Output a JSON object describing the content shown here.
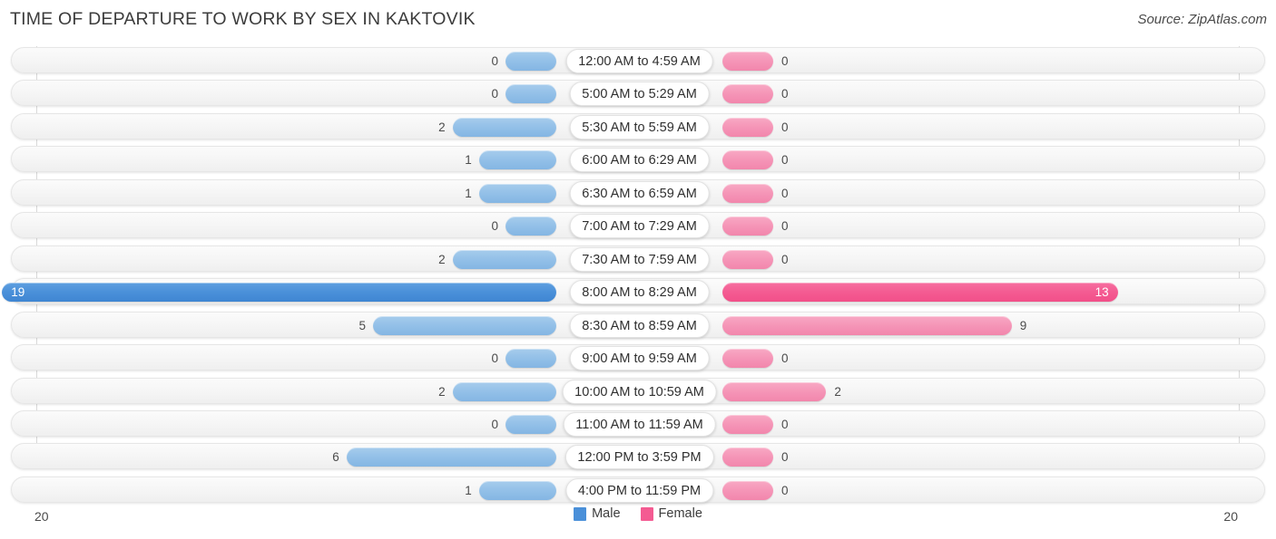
{
  "header": {
    "title": "TIME OF DEPARTURE TO WORK BY SEX IN KAKTOVIK",
    "source": "Source: ZipAtlas.com"
  },
  "axis": {
    "left_max": "20",
    "right_max": "20"
  },
  "legend": {
    "items": [
      {
        "label": "Male",
        "color": "#4a90d9"
      },
      {
        "label": "Female",
        "color": "#f45b92"
      }
    ]
  },
  "colors": {
    "male_light": "#93c0e8",
    "female_light": "#f595b7",
    "male_strong": "#4a90d9",
    "female_strong": "#f45b92",
    "row_background": "#f5f5f5",
    "gridline": "#d9d9d9"
  },
  "chart_data": {
    "type": "bar",
    "title": "TIME OF DEPARTURE TO WORK BY SEX IN KAKTOVIK",
    "subtitle": "Source: ZipAtlas.com",
    "orientation": "horizontal-diverging",
    "xlabel": "",
    "ylabel": "",
    "xlim": [
      20,
      20
    ],
    "axis_tick_labels": [
      "20",
      "20"
    ],
    "grid": true,
    "legend_position": "bottom-center",
    "categories": [
      "12:00 AM to 4:59 AM",
      "5:00 AM to 5:29 AM",
      "5:30 AM to 5:59 AM",
      "6:00 AM to 6:29 AM",
      "6:30 AM to 6:59 AM",
      "7:00 AM to 7:29 AM",
      "7:30 AM to 7:59 AM",
      "8:00 AM to 8:29 AM",
      "8:30 AM to 8:59 AM",
      "9:00 AM to 9:59 AM",
      "10:00 AM to 10:59 AM",
      "11:00 AM to 11:59 AM",
      "12:00 PM to 3:59 PM",
      "4:00 PM to 11:59 PM"
    ],
    "series": [
      {
        "name": "Male",
        "values": [
          0,
          0,
          2,
          1,
          1,
          0,
          2,
          19,
          5,
          0,
          2,
          0,
          6,
          1
        ]
      },
      {
        "name": "Female",
        "values": [
          0,
          0,
          0,
          0,
          0,
          0,
          0,
          13,
          9,
          0,
          2,
          0,
          0,
          0
        ]
      }
    ],
    "highlighted_category": "8:00 AM to 8:29 AM"
  },
  "rows": [
    {
      "label": "12:00 AM to 4:59 AM",
      "male": "0",
      "female": "0",
      "male_value": 0,
      "female_value": 0,
      "highlight": false
    },
    {
      "label": "5:00 AM to 5:29 AM",
      "male": "0",
      "female": "0",
      "male_value": 0,
      "female_value": 0,
      "highlight": false
    },
    {
      "label": "5:30 AM to 5:59 AM",
      "male": "2",
      "female": "0",
      "male_value": 2,
      "female_value": 0,
      "highlight": false
    },
    {
      "label": "6:00 AM to 6:29 AM",
      "male": "1",
      "female": "0",
      "male_value": 1,
      "female_value": 0,
      "highlight": false
    },
    {
      "label": "6:30 AM to 6:59 AM",
      "male": "1",
      "female": "0",
      "male_value": 1,
      "female_value": 0,
      "highlight": false
    },
    {
      "label": "7:00 AM to 7:29 AM",
      "male": "0",
      "female": "0",
      "male_value": 0,
      "female_value": 0,
      "highlight": false
    },
    {
      "label": "7:30 AM to 7:59 AM",
      "male": "2",
      "female": "0",
      "male_value": 2,
      "female_value": 0,
      "highlight": false
    },
    {
      "label": "8:00 AM to 8:29 AM",
      "male": "19",
      "female": "13",
      "male_value": 19,
      "female_value": 13,
      "highlight": true
    },
    {
      "label": "8:30 AM to 8:59 AM",
      "male": "5",
      "female": "9",
      "male_value": 5,
      "female_value": 9,
      "highlight": false
    },
    {
      "label": "9:00 AM to 9:59 AM",
      "male": "0",
      "female": "0",
      "male_value": 0,
      "female_value": 0,
      "highlight": false
    },
    {
      "label": "10:00 AM to 10:59 AM",
      "male": "2",
      "female": "2",
      "male_value": 2,
      "female_value": 2,
      "highlight": false
    },
    {
      "label": "11:00 AM to 11:59 AM",
      "male": "0",
      "female": "0",
      "male_value": 0,
      "female_value": 0,
      "highlight": false
    },
    {
      "label": "12:00 PM to 3:59 PM",
      "male": "6",
      "female": "0",
      "male_value": 6,
      "female_value": 0,
      "highlight": false
    },
    {
      "label": "4:00 PM to 11:59 PM",
      "male": "1",
      "female": "0",
      "male_value": 1,
      "female_value": 0,
      "highlight": false
    }
  ]
}
